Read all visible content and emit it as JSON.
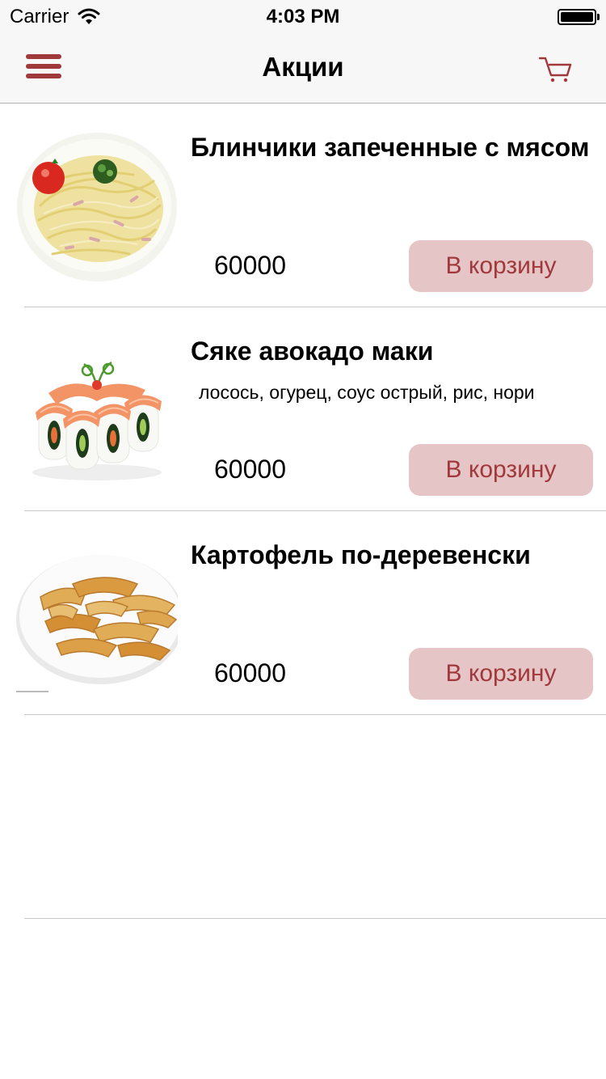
{
  "status_bar": {
    "carrier": "Carrier",
    "time": "4:03 PM"
  },
  "nav": {
    "title": "Акции",
    "menu_icon": "hamburger-menu-icon",
    "cart_icon": "cart-icon",
    "accent_color": "#a0393b"
  },
  "products": [
    {
      "title": "Блинчики запеченные с мясом",
      "description": "",
      "price": "60000",
      "button_label": "В корзину",
      "image": "pasta-carbonara-image"
    },
    {
      "title": "Сяке авокадо маки",
      "description": "лосось, огурец, соус острый, рис, нори",
      "price": "60000",
      "button_label": "В корзину",
      "image": "salmon-avocado-rolls-image"
    },
    {
      "title": "Картофель по-деревенски",
      "description": "",
      "price": "60000",
      "button_label": "В корзину",
      "image": "potato-wedges-image"
    }
  ],
  "colors": {
    "button_bg": "#e6c5c6",
    "button_text": "#a1393c",
    "separator": "#c8c7cc"
  }
}
